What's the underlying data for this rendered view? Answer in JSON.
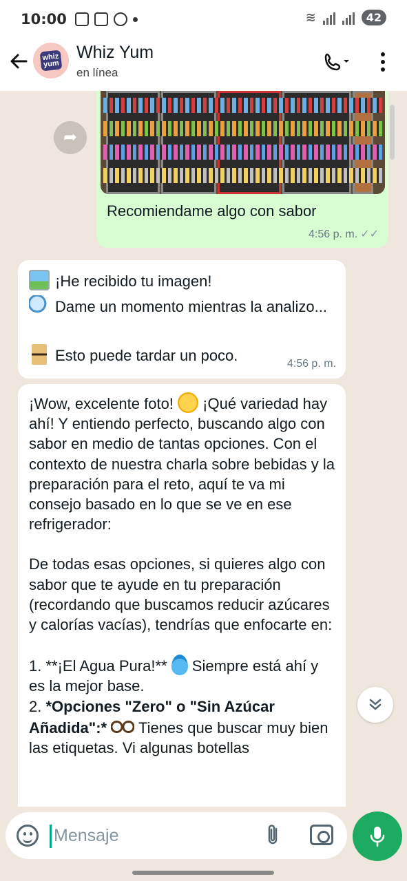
{
  "status_bar": {
    "time": "10:00",
    "battery": "42"
  },
  "header": {
    "contact_name": "Whiz Yum",
    "contact_status": "en línea",
    "avatar_text": "whiz yum"
  },
  "messages": {
    "outgoing": {
      "text": "Recomiendame algo con sabor",
      "time": "4:56 p. m."
    },
    "incoming_1": {
      "line1": "¡He recibido tu imagen!",
      "line2": "Dame un momento mientras la analizo...",
      "line3": "Esto puede tardar un poco.",
      "time": "4:56 p. m."
    },
    "incoming_2": {
      "p1_a": "¡Wow, excelente foto! ",
      "p1_b": " ¡Qué variedad hay ahí! Y entiendo perfecto, buscando algo con sabor en medio de tantas opciones. Con el contexto de nuestra charla sobre bebidas y la preparación para el reto, aquí te va mi consejo basado en lo que se ve en ese refrigerador:",
      "p2": "De todas esas opciones, si quieres algo con sabor que te ayude en tu preparación (recordando que buscamos reducir azúcares y calorías vacías), tendrías que enfocarte en:",
      "item1_a": "1.  **¡El Agua Pura!** ",
      "item1_b": " Siempre está ahí y es la mejor base.",
      "item2_num": "2.  ",
      "item2_bold": "*Opciones \"Zero\" o \"Sin Azúcar Añadida\":*",
      "item2_b": " Tienes que buscar muy bien las etiquetas. Vi algunas botellas"
    }
  },
  "input": {
    "placeholder": "Mensaje"
  },
  "icons": {
    "back": "arrow-left-icon",
    "call": "phone-icon",
    "menu": "more-vertical-icon",
    "forward": "forward-icon",
    "scroll_down": "chevron-double-down-icon",
    "emoji": "emoji-icon",
    "attach": "paperclip-icon",
    "camera": "camera-icon",
    "mic": "microphone-icon"
  },
  "colors": {
    "outgoing_bubble": "#d9fdd3",
    "incoming_bubble": "#ffffff",
    "chat_bg": "#efe7de",
    "mic_button": "#1daa61"
  }
}
